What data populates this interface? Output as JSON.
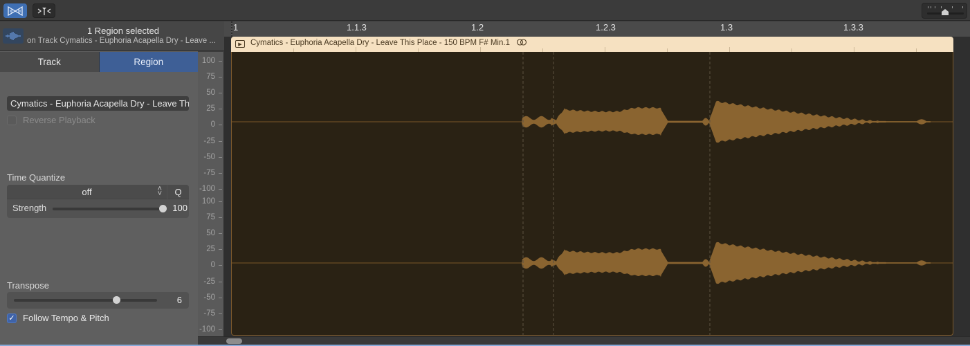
{
  "toolbar": {
    "buttons": [
      {
        "name": "audio-editor-mode",
        "icon": "bowtie-waveform-icon",
        "active": true
      },
      {
        "name": "catch-playhead",
        "icon": "flex-marker-icon",
        "active": false
      }
    ],
    "zoom_slider": {
      "icon": "zoom-slider",
      "value": 0.55
    }
  },
  "inspector": {
    "header": {
      "icon": "audio-waveform-icon",
      "title": "1 Region selected",
      "subtitle": "on Track Cymatics - Euphoria Acapella Dry - Leave ..."
    },
    "tabs": [
      {
        "label": "Track",
        "selected": false
      },
      {
        "label": "Region",
        "selected": true
      }
    ],
    "region_name": "Cymatics - Euphoria Acapella Dry - Leave This Place - 150 BPM F# Min.1",
    "reverse_playback": {
      "label": "Reverse Playback",
      "checked": false,
      "enabled": false
    },
    "time_quantize": {
      "label": "Time Quantize",
      "value": "off",
      "q_button": "Q",
      "strength_label": "Strength",
      "strength_value": "100",
      "strength_fraction": 1.0
    },
    "transpose": {
      "label": "Transpose",
      "value": "6",
      "fraction": 0.72
    },
    "follow_tempo": {
      "label": "Follow Tempo & Pitch",
      "checked": true
    }
  },
  "scale": {
    "channels": [
      [
        "100",
        "75",
        "50",
        "25",
        "0",
        "-25",
        "-50",
        "-75",
        "-100"
      ],
      [
        "100",
        "75",
        "50",
        "25",
        "0",
        "-25",
        "-50",
        "-75",
        "-100"
      ]
    ]
  },
  "ruler": {
    "labels": [
      "1",
      "1.1.3",
      "1.2",
      "1.2.3",
      "1.3",
      "1.3.3"
    ]
  },
  "region": {
    "title": "Cymatics - Euphoria Acapella Dry - Leave This Place - 150 BPM F# Min.1",
    "icon": "play-region-icon",
    "loop_icon": "stereo-link-icon",
    "colors": {
      "header": "#f6e1c1",
      "waveform": "#8a6430",
      "background": "#2a2214",
      "center_line": "#7a5728"
    }
  }
}
